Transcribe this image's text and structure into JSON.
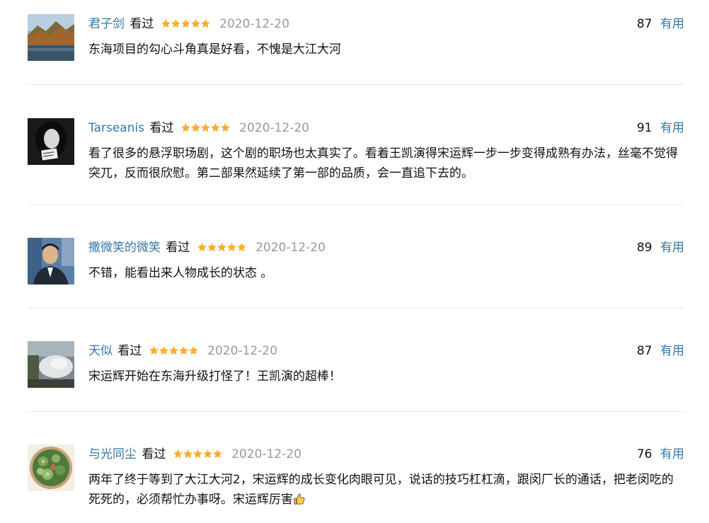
{
  "comments": [
    {
      "user": "君子剑",
      "status": "看过",
      "rating": 5,
      "date": "2020-12-20",
      "votes": "87",
      "useful_label": "有用",
      "text": "东海项目的勾心斗角真是好看，不愧是大江大河",
      "avatar": "landscape-avatar"
    },
    {
      "user": "Tarseanis",
      "status": "看过",
      "rating": 5,
      "date": "2020-12-20",
      "votes": "91",
      "useful_label": "有用",
      "text": "看了很多的悬浮职场剧，这个剧的职场也太真实了。看着王凯演得宋运辉一步一步变得成熟有办法，丝毫不觉得突兀，反而很欣慰。第二部果然延续了第一部的品质，会一直追下去的。",
      "avatar": "bw-portrait-avatar"
    },
    {
      "user": "撒微笑的微笑",
      "status": "看过",
      "rating": 5,
      "date": "2020-12-20",
      "votes": "89",
      "useful_label": "有用",
      "text": "不错，能看出来人物成长的状态 。",
      "avatar": "man-portrait-avatar"
    },
    {
      "user": "天似",
      "status": "看过",
      "rating": 5,
      "date": "2020-12-20",
      "votes": "87",
      "useful_label": "有用",
      "text": "宋运辉开始在东海升级打怪了！王凯演的超棒！",
      "avatar": "blur-photo-avatar"
    },
    {
      "user": "与光同尘",
      "status": "看过",
      "rating": 5,
      "date": "2020-12-20",
      "votes": "76",
      "useful_label": "有用",
      "text": "两年了终于等到了大江大河2，宋运辉的成长变化肉眼可见，说话的技巧杠杠滴，跟闵厂长的通话，把老闵吃的死死的，必须帮忙办事呀。宋运辉厉害",
      "text_icon": "thumbs-up-icon",
      "avatar": "succulent-avatar"
    }
  ],
  "colors": {
    "link": "#3377aa",
    "star": "#ffac2d",
    "muted": "#999999",
    "divider": "#eaeaea"
  }
}
